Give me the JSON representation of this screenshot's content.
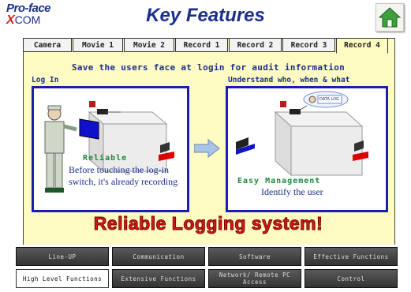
{
  "header": {
    "logo_top": "Pro-face",
    "logo_bottom_x": "X",
    "logo_bottom_rest": "COM",
    "title": "Key Features"
  },
  "tabs": [
    {
      "label": "Camera",
      "active": false
    },
    {
      "label": "Movie 1",
      "active": false
    },
    {
      "label": "Movie 2",
      "active": false
    },
    {
      "label": "Record 1",
      "active": false
    },
    {
      "label": "Record 2",
      "active": false
    },
    {
      "label": "Record 3",
      "active": false
    },
    {
      "label": "Record 4",
      "active": true
    }
  ],
  "content": {
    "headline": "Save the users face at login for audit information",
    "left_label": "Log In",
    "right_label": "Understand who, when & what",
    "left_heading": "Reliable",
    "left_desc_1": "Before touching the log-in",
    "left_desc_2": "switch, it's already recording",
    "right_heading": "Easy Management",
    "right_desc": "Identify the user",
    "data_log_label": "DATA LOG",
    "slogan": "Reliable Logging system!"
  },
  "nav": {
    "row1": [
      "Line-UP",
      "Communication",
      "Software",
      "Effective Functions"
    ],
    "row2": [
      "High Level Functions",
      "Extensive Functions",
      "Network/ Remote PC Access",
      "Control"
    ],
    "active": "High Level Functions"
  },
  "colors": {
    "brand_blue": "#1b2f8c",
    "panel_yellow": "#fefbc2",
    "frame_blue": "#1a1eb0",
    "accent_red": "#d21c1c",
    "accent_green": "#1a8a3a"
  }
}
